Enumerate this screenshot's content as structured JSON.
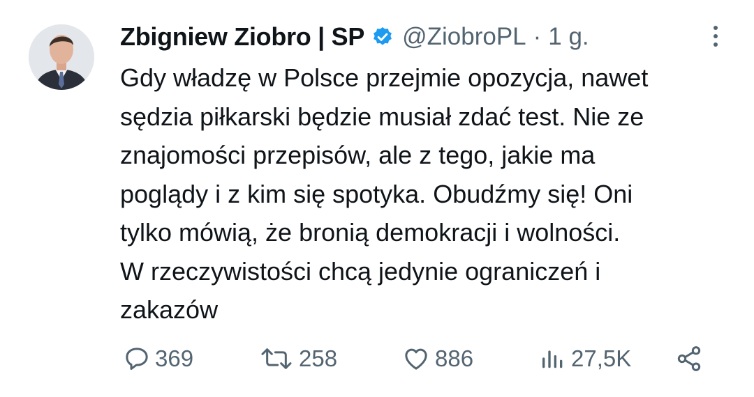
{
  "tweet": {
    "author_name": "Zbigniew Ziobro | SP",
    "handle": "@ZiobroPL",
    "separator": "·",
    "time": "1 g.",
    "text": "Gdy władzę w Polsce przejmie opozycja, nawet\nsędzia piłkarski będzie musiał zdać test. Nie ze\nznajomości przepisów, ale z tego, jakie ma\npoglądy i z kim się spotyka. Obudźmy się! Oni\ntylko mówią, że bronią demokracji i wolności.\nW rzeczywistości chcą jedynie ograniczeń i\nzakazów"
  },
  "actions": {
    "replies": "369",
    "reposts": "258",
    "likes": "886",
    "views": "27,5K"
  },
  "icons": {
    "verified": "verified-badge-icon",
    "more": "more-vertical-icon",
    "reply": "reply-icon",
    "repost": "repost-icon",
    "like": "heart-icon",
    "views": "views-icon",
    "share": "share-icon"
  },
  "colors": {
    "text": "#0f1419",
    "secondary": "#536471",
    "verified": "#1d9bf0",
    "background": "#ffffff"
  }
}
